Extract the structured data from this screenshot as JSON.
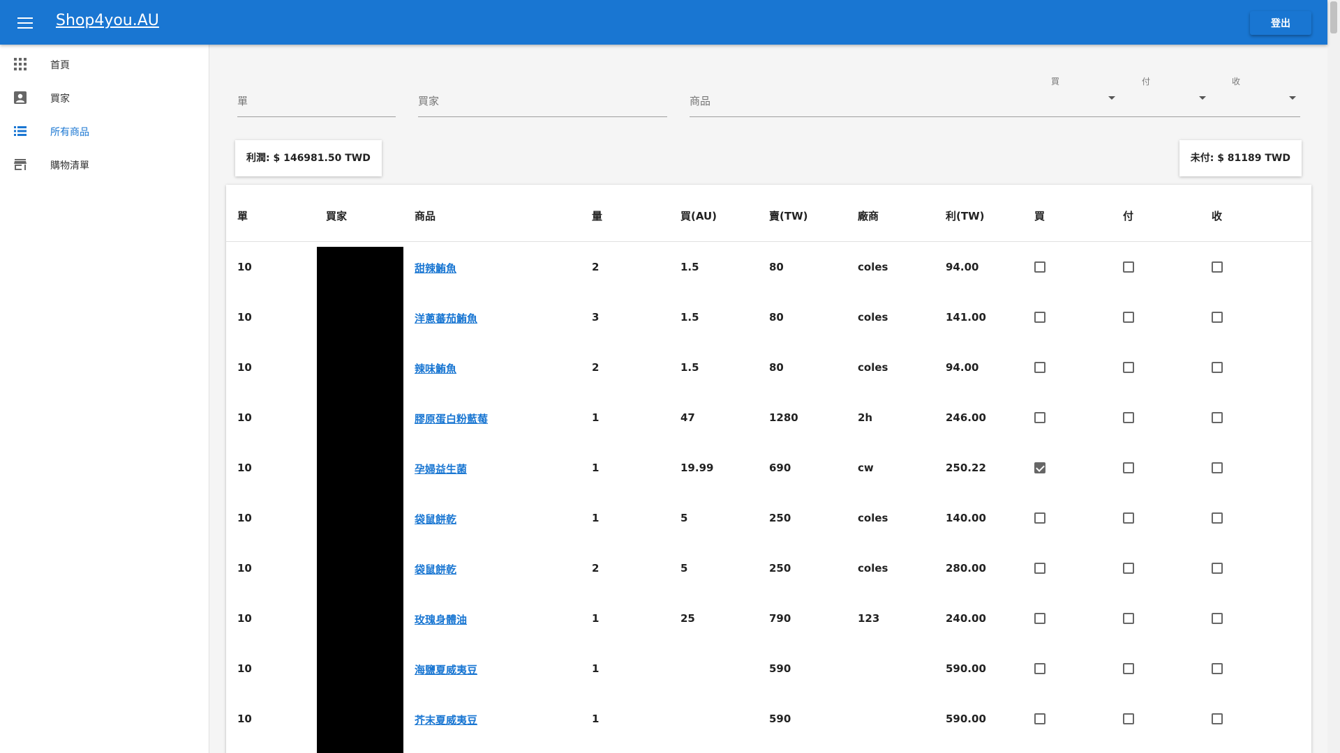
{
  "header": {
    "brand": "Shop4you.AU",
    "logout_label": "登出"
  },
  "sidebar": {
    "items": [
      {
        "label": "首頁",
        "icon": "apps-icon",
        "active": false
      },
      {
        "label": "買家",
        "icon": "account-box-icon",
        "active": false
      },
      {
        "label": "所有商品",
        "icon": "list-icon",
        "active": true
      },
      {
        "label": "購物清單",
        "icon": "store-icon",
        "active": false
      }
    ]
  },
  "filters": {
    "order_placeholder": "單",
    "buyer_placeholder": "買家",
    "product_placeholder": "商品",
    "buy_label": "買",
    "pay_label": "付",
    "receive_label": "收"
  },
  "summary": {
    "profit": "利潤: $ 146981.50 TWD",
    "unpaid": "未付: $ 81189 TWD"
  },
  "table": {
    "columns": [
      "單",
      "買家",
      "商品",
      "量",
      "買(AU)",
      "賣(TW)",
      "廠商",
      "利(TW)",
      "買",
      "付",
      "收"
    ],
    "rows": [
      {
        "order": "10",
        "buyer": "",
        "product": "甜辣鮪魚",
        "qty": "2",
        "buy_au": "1.5",
        "sell_tw": "80",
        "vendor": "coles",
        "profit_tw": "94.00",
        "bought": false,
        "paid": false,
        "received": false
      },
      {
        "order": "10",
        "buyer": "",
        "product": "洋蔥蕃茄鮪魚",
        "qty": "3",
        "buy_au": "1.5",
        "sell_tw": "80",
        "vendor": "coles",
        "profit_tw": "141.00",
        "bought": false,
        "paid": false,
        "received": false
      },
      {
        "order": "10",
        "buyer": "",
        "product": "辣味鮪魚",
        "qty": "2",
        "buy_au": "1.5",
        "sell_tw": "80",
        "vendor": "coles",
        "profit_tw": "94.00",
        "bought": false,
        "paid": false,
        "received": false
      },
      {
        "order": "10",
        "buyer": "",
        "product": "膠原蛋白粉藍莓",
        "qty": "1",
        "buy_au": "47",
        "sell_tw": "1280",
        "vendor": "2h",
        "profit_tw": "246.00",
        "bought": false,
        "paid": false,
        "received": false
      },
      {
        "order": "10",
        "buyer": "",
        "product": "孕婦益生菌",
        "qty": "1",
        "buy_au": "19.99",
        "sell_tw": "690",
        "vendor": "cw",
        "profit_tw": "250.22",
        "bought": true,
        "paid": false,
        "received": false
      },
      {
        "order": "10",
        "buyer": "",
        "product": "袋鼠餅乾",
        "qty": "1",
        "buy_au": "5",
        "sell_tw": "250",
        "vendor": "coles",
        "profit_tw": "140.00",
        "bought": false,
        "paid": false,
        "received": false
      },
      {
        "order": "10",
        "buyer": "",
        "product": "袋鼠餅乾",
        "qty": "2",
        "buy_au": "5",
        "sell_tw": "250",
        "vendor": "coles",
        "profit_tw": "280.00",
        "bought": false,
        "paid": false,
        "received": false
      },
      {
        "order": "10",
        "buyer": "",
        "product": "玫瑰身體油",
        "qty": "1",
        "buy_au": "25",
        "sell_tw": "790",
        "vendor": "123",
        "profit_tw": "240.00",
        "bought": false,
        "paid": false,
        "received": false
      },
      {
        "order": "10",
        "buyer": "",
        "product": "海鹽夏威夷豆",
        "qty": "1",
        "buy_au": "",
        "sell_tw": "590",
        "vendor": "",
        "profit_tw": "590.00",
        "bought": false,
        "paid": false,
        "received": false
      },
      {
        "order": "10",
        "buyer": "",
        "product": "芥末夏威夷豆",
        "qty": "1",
        "buy_au": "",
        "sell_tw": "590",
        "vendor": "",
        "profit_tw": "590.00",
        "bought": false,
        "paid": false,
        "received": false
      }
    ]
  },
  "colors": {
    "primary": "#1976d2",
    "background": "#f5f5f5",
    "redaction": "#000000"
  }
}
